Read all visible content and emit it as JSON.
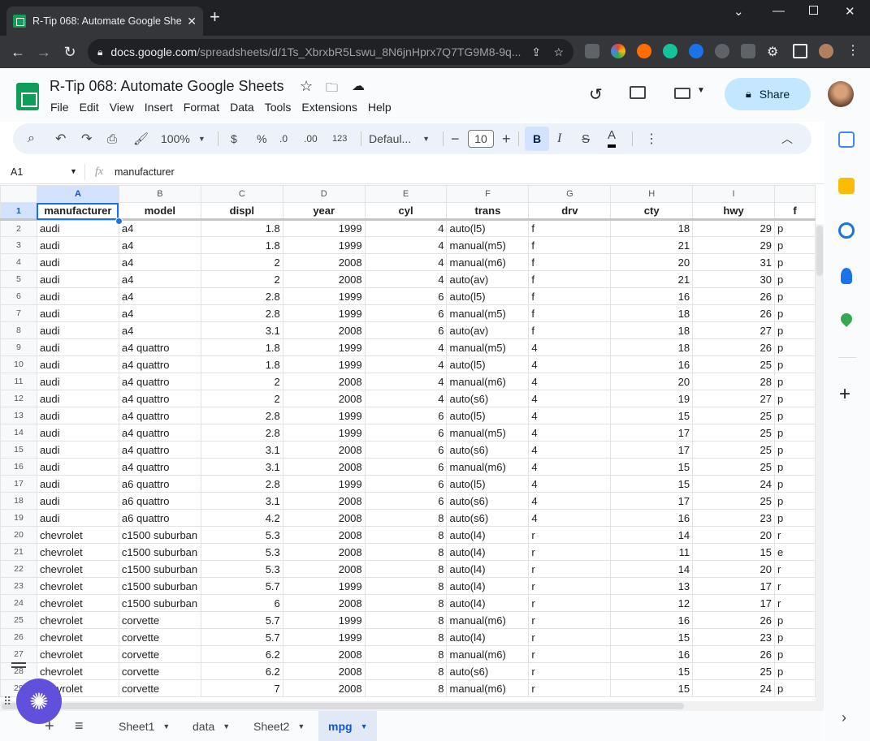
{
  "browser": {
    "tab_title": "R-Tip 068: Automate Google She",
    "url_host": "docs.google.com",
    "url_path": "/spreadsheets/d/1Ts_XbrxbR5Lswu_8N6jnHprx7Q7TG9M8-9q..."
  },
  "doc": {
    "title": "R-Tip 068: Automate Google Sheets",
    "menus": [
      "File",
      "Edit",
      "View",
      "Insert",
      "Format",
      "Data",
      "Tools",
      "Extensions",
      "Help"
    ],
    "share_label": "Share"
  },
  "toolbar": {
    "zoom": "100%",
    "currency": "$",
    "percent": "%",
    "dec_less": ".0",
    "dec_more": ".00",
    "num_format": "123",
    "font": "Defaul...",
    "font_size": "10",
    "bold": "B",
    "italic": "I",
    "strike": "S",
    "text_color": "A"
  },
  "formula_bar": {
    "cell_ref": "A1",
    "fx": "fx",
    "content": "manufacturer"
  },
  "grid": {
    "columns": [
      "A",
      "B",
      "C",
      "D",
      "E",
      "F",
      "G",
      "H",
      "I",
      ""
    ],
    "headers": [
      "manufacturer",
      "model",
      "displ",
      "year",
      "cyl",
      "trans",
      "drv",
      "cty",
      "hwy",
      "f"
    ],
    "rows": [
      [
        "2",
        "audi",
        "a4",
        "1.8",
        "1999",
        "4",
        "auto(l5)",
        "f",
        "18",
        "29",
        "p"
      ],
      [
        "3",
        "audi",
        "a4",
        "1.8",
        "1999",
        "4",
        "manual(m5)",
        "f",
        "21",
        "29",
        "p"
      ],
      [
        "4",
        "audi",
        "a4",
        "2",
        "2008",
        "4",
        "manual(m6)",
        "f",
        "20",
        "31",
        "p"
      ],
      [
        "5",
        "audi",
        "a4",
        "2",
        "2008",
        "4",
        "auto(av)",
        "f",
        "21",
        "30",
        "p"
      ],
      [
        "6",
        "audi",
        "a4",
        "2.8",
        "1999",
        "6",
        "auto(l5)",
        "f",
        "16",
        "26",
        "p"
      ],
      [
        "7",
        "audi",
        "a4",
        "2.8",
        "1999",
        "6",
        "manual(m5)",
        "f",
        "18",
        "26",
        "p"
      ],
      [
        "8",
        "audi",
        "a4",
        "3.1",
        "2008",
        "6",
        "auto(av)",
        "f",
        "18",
        "27",
        "p"
      ],
      [
        "9",
        "audi",
        "a4 quattro",
        "1.8",
        "1999",
        "4",
        "manual(m5)",
        "4",
        "18",
        "26",
        "p"
      ],
      [
        "10",
        "audi",
        "a4 quattro",
        "1.8",
        "1999",
        "4",
        "auto(l5)",
        "4",
        "16",
        "25",
        "p"
      ],
      [
        "11",
        "audi",
        "a4 quattro",
        "2",
        "2008",
        "4",
        "manual(m6)",
        "4",
        "20",
        "28",
        "p"
      ],
      [
        "12",
        "audi",
        "a4 quattro",
        "2",
        "2008",
        "4",
        "auto(s6)",
        "4",
        "19",
        "27",
        "p"
      ],
      [
        "13",
        "audi",
        "a4 quattro",
        "2.8",
        "1999",
        "6",
        "auto(l5)",
        "4",
        "15",
        "25",
        "p"
      ],
      [
        "14",
        "audi",
        "a4 quattro",
        "2.8",
        "1999",
        "6",
        "manual(m5)",
        "4",
        "17",
        "25",
        "p"
      ],
      [
        "15",
        "audi",
        "a4 quattro",
        "3.1",
        "2008",
        "6",
        "auto(s6)",
        "4",
        "17",
        "25",
        "p"
      ],
      [
        "16",
        "audi",
        "a4 quattro",
        "3.1",
        "2008",
        "6",
        "manual(m6)",
        "4",
        "15",
        "25",
        "p"
      ],
      [
        "17",
        "audi",
        "a6 quattro",
        "2.8",
        "1999",
        "6",
        "auto(l5)",
        "4",
        "15",
        "24",
        "p"
      ],
      [
        "18",
        "audi",
        "a6 quattro",
        "3.1",
        "2008",
        "6",
        "auto(s6)",
        "4",
        "17",
        "25",
        "p"
      ],
      [
        "19",
        "audi",
        "a6 quattro",
        "4.2",
        "2008",
        "8",
        "auto(s6)",
        "4",
        "16",
        "23",
        "p"
      ],
      [
        "20",
        "chevrolet",
        "c1500 suburban",
        "5.3",
        "2008",
        "8",
        "auto(l4)",
        "r",
        "14",
        "20",
        "r"
      ],
      [
        "21",
        "chevrolet",
        "c1500 suburban",
        "5.3",
        "2008",
        "8",
        "auto(l4)",
        "r",
        "11",
        "15",
        "e"
      ],
      [
        "22",
        "chevrolet",
        "c1500 suburban",
        "5.3",
        "2008",
        "8",
        "auto(l4)",
        "r",
        "14",
        "20",
        "r"
      ],
      [
        "23",
        "chevrolet",
        "c1500 suburban",
        "5.7",
        "1999",
        "8",
        "auto(l4)",
        "r",
        "13",
        "17",
        "r"
      ],
      [
        "24",
        "chevrolet",
        "c1500 suburban",
        "6",
        "2008",
        "8",
        "auto(l4)",
        "r",
        "12",
        "17",
        "r"
      ],
      [
        "25",
        "chevrolet",
        "corvette",
        "5.7",
        "1999",
        "8",
        "manual(m6)",
        "r",
        "16",
        "26",
        "p"
      ],
      [
        "26",
        "chevrolet",
        "corvette",
        "5.7",
        "1999",
        "8",
        "auto(l4)",
        "r",
        "15",
        "23",
        "p"
      ],
      [
        "27",
        "chevrolet",
        "corvette",
        "6.2",
        "2008",
        "8",
        "manual(m6)",
        "r",
        "16",
        "26",
        "p"
      ],
      [
        "28",
        "chevrolet",
        "corvette",
        "6.2",
        "2008",
        "8",
        "auto(s6)",
        "r",
        "15",
        "25",
        "p"
      ],
      [
        "29",
        "chevrolet",
        "corvette",
        "7",
        "2008",
        "8",
        "manual(m6)",
        "r",
        "15",
        "24",
        "p"
      ]
    ]
  },
  "sheets": {
    "tabs": [
      "Sheet1",
      "data",
      "Sheet2",
      "mpg"
    ],
    "active": "mpg"
  },
  "colors": {
    "accent": "#1a73e8",
    "share_bg": "#c2e7ff",
    "sheets_green": "#0f9d58",
    "fab": "#6050dc"
  }
}
